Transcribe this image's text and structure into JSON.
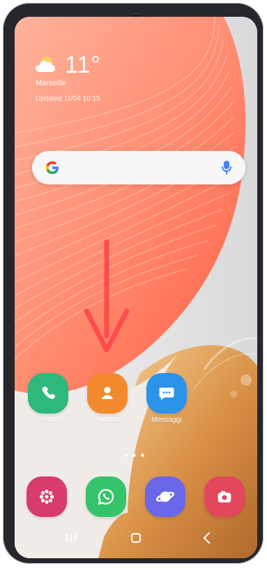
{
  "widget": {
    "temperature": "11°",
    "location": "Marseille",
    "updated": "Updated 11/04 10:15"
  },
  "search": {
    "logo": "google-icon",
    "voice": "mic-icon"
  },
  "apps": [
    {
      "label": "Telefono",
      "icon": "phone-icon",
      "color": "#2eb87b"
    },
    {
      "label": "Rubrica",
      "icon": "contacts-icon",
      "color": "#f28a2d"
    },
    {
      "label": "Messaggi",
      "icon": "messages-icon",
      "color": "#2b93e8"
    }
  ],
  "dock": [
    {
      "icon": "flower-icon",
      "color": "#d83c6b"
    },
    {
      "icon": "whatsapp-icon",
      "color": "#36c46b"
    },
    {
      "icon": "browser-icon",
      "color": "#6a68e8"
    },
    {
      "icon": "camera-icon",
      "color": "#e3475b"
    }
  ],
  "page_dots": 3,
  "navigation": {
    "recent": "recent-apps-icon",
    "home": "home-icon",
    "back": "back-icon"
  },
  "colors": {
    "frame": "#26272d",
    "arrow": "#ff4b4b",
    "wallpaper_orange": "#ff8e73"
  }
}
